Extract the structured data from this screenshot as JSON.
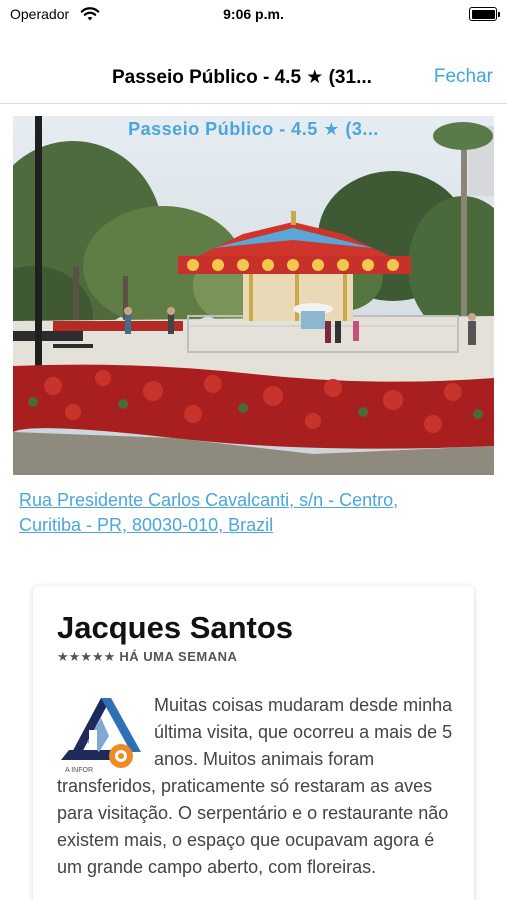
{
  "status": {
    "carrier": "Operador",
    "time": "9:06 p.m.",
    "battery_level": 1.0
  },
  "nav": {
    "title": "Passeio Público - 4.5 ★ (31...",
    "close_label": "Fechar"
  },
  "photo": {
    "caption": "Passeio Público - 4.5 ★ (3..."
  },
  "address": {
    "line1": "Rua Presidente Carlos Cavalcanti, s/n - Centro,",
    "line2": "Curitiba - PR, 80030-010, Brazil"
  },
  "review": {
    "author": "Jacques Santos",
    "stars": "★★★★★",
    "rating": 5,
    "when": "HÁ UMA SEMANA",
    "logo_caption": "A INFOR",
    "text": "Muitas coisas mudaram desde minha última visita, que ocorreu a mais de 5 anos. Muitos animais foram transferidos, praticamente só restaram as aves para visitação. O serpentário e o restaurante não existem mais, o espaço que ocupavam agora é um grande campo aberto, com floreiras."
  },
  "colors": {
    "link": "#4aa6dc",
    "nav_button": "#3ea6e0"
  },
  "icons": {
    "wifi": "wifi-icon",
    "battery": "battery-icon"
  }
}
